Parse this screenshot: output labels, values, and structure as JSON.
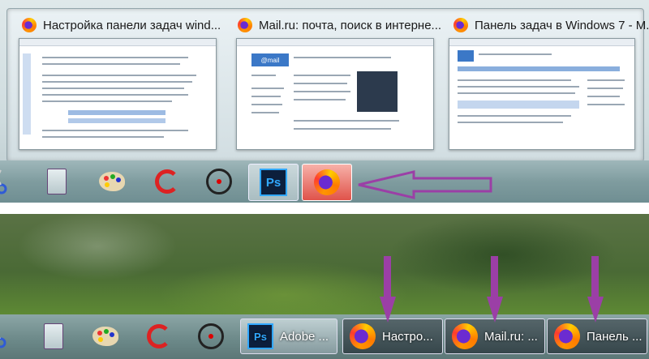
{
  "top_panel": {
    "thumbnails": [
      {
        "title": "Настройка панели задач wind..."
      },
      {
        "title": "Mail.ru: почта, поиск в интерне..."
      },
      {
        "title": "Панель задач в Windows 7 - M..."
      }
    ],
    "mailru_logo": "@mail",
    "taskbar_icons": [
      "scissors-icon",
      "calculator-icon",
      "paint-palette-icon",
      "ccleaner-icon",
      "record-icon",
      "photoshop-icon",
      "firefox-icon"
    ],
    "ps_label": "Ps"
  },
  "bottom_panel": {
    "ps_label": "Ps",
    "adobe_label": "Adobe ...",
    "tabs": [
      {
        "label": "Настро..."
      },
      {
        "label": "Mail.ru: ..."
      },
      {
        "label": "Панель ..."
      }
    ]
  },
  "colors": {
    "arrow": "#9b3fa6",
    "taskbar": "#7f9c9f",
    "firefox_active": "#e0534a"
  }
}
